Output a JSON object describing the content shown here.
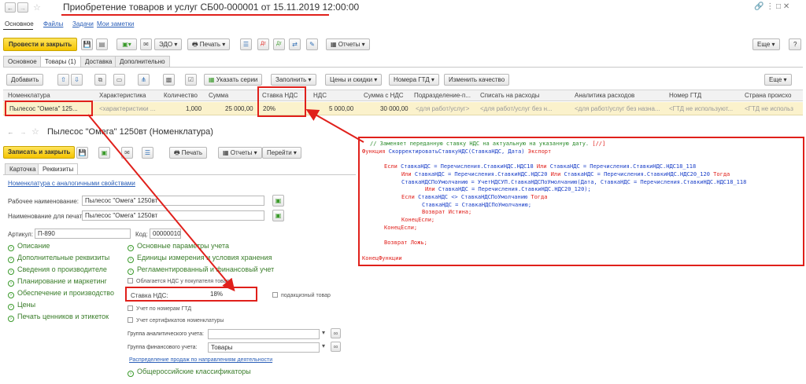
{
  "window": {
    "title": "Приобретение товаров и услуг СБ00-000001 от 15.11.2019 12:00:00"
  },
  "nav_tabs": [
    "Основное",
    "Файлы",
    "Задачи",
    "Мои заметки"
  ],
  "toolbar": {
    "post_close": "Провести и закрыть",
    "edo": "ЭДО",
    "print": "Печать",
    "reports": "Отчеты",
    "more": "Еще",
    "help": "?"
  },
  "doc_tabs": [
    "Основное",
    "Товары (1)",
    "Доставка",
    "Дополнительно"
  ],
  "goods_toolbar": {
    "add": "Добавить",
    "specify_series": "Указать серии",
    "fill": "Заполнить",
    "prices": "Цены и скидки",
    "gtd_numbers": "Номера ГТД",
    "change_quality": "Изменить качество",
    "more": "Еще"
  },
  "table": {
    "headers": [
      "Номенклатура",
      "Характеристика",
      "Количество",
      "Сумма",
      "Ставка НДС",
      "НДС",
      "Сумма с НДС",
      "Подразделение-п...",
      "Списать на расходы",
      "Аналитика расходов",
      "Номер ГТД",
      "Страна происхо"
    ],
    "row": [
      "Пылесос \"Омега\" 125...",
      "<характеристики ...",
      "1,000",
      "25 000,00",
      "20%",
      "5 000,00",
      "30 000,00",
      "<для работ/услуг>",
      "<для работ/услуг без н...",
      "<для работ/услуг без назна...",
      "<ГТД не используют...",
      "<ГТД не использ"
    ]
  },
  "item": {
    "title": "Пылесос \"Омега\" 1250вт (Номенклатура)",
    "save_close": "Записать и закрыть",
    "print": "Печать",
    "reports": "Отчеты",
    "goto": "Перейти",
    "tabs": [
      "Карточка",
      "Реквизиты"
    ],
    "analog_link": "Номенклатура с аналогичными свойствами",
    "work_name_label": "Рабочее наименование:",
    "work_name_value": "Пылесос \"Омега\" 1250вт",
    "print_name_label": "Наименование для печати:",
    "print_name_value": "Пылесос \"Омега\" 1250вт",
    "article_label": "Артикул:",
    "article_value": "П-890",
    "code_label": "Код:",
    "code_value": "000000104",
    "left_groups": [
      "Описание",
      "Дополнительные реквизиты",
      "Сведения о производителе",
      "Планирование и маркетинг",
      "Обеспечение и производство",
      "Цены",
      "Печать ценников и этикеток"
    ],
    "right_groups": [
      "Основные параметры учета",
      "Единицы измерения и условия хранения",
      "Регламентированный и финансовый учет"
    ],
    "vat_buyer": "Облагается НДС у покупателя товара",
    "vat_rate_label": "Ставка НДС:",
    "vat_rate_value": "18%",
    "excise": "подакцизный товар",
    "gtd_check": "Учет по номерам ГТД",
    "cert_check": "Учет сертификатов номенклатуры",
    "analytic_group_label": "Группа аналитического учета:",
    "analytic_group_value": "",
    "fin_group_label": "Группа финансового учета:",
    "fin_group_value": "Товары",
    "sales_link": "Распределение продаж по направлениям деятельности",
    "classifiers": "Общероссийские классификаторы"
  },
  "code": {
    "lines": [
      {
        "parts": [
          [
            "cm",
            "// Заменяет переданную ставку НДС на актуальную на указанную дату. "
          ],
          [
            "kw",
            "[//]"
          ]
        ]
      },
      {
        "parts": [
          [
            "kw",
            "Функция "
          ],
          [
            "tx",
            "СкорректироватьСтавкуНДС(СтавкаНДС, Дата) "
          ],
          [
            "kw",
            "Экспорт"
          ]
        ]
      },
      {
        "parts": []
      },
      {
        "parts": [
          [
            "kw",
            "Если "
          ],
          [
            "tx",
            "СтавкаНДС = Перечисления.СтавкиНДС.НДС18 "
          ],
          [
            "kw",
            "Или "
          ],
          [
            "tx",
            "СтавкаНДС = Перечисления.СтавкиНДС.НДС18_118"
          ]
        ]
      },
      {
        "parts": [
          [
            "kw",
            "Или "
          ],
          [
            "tx",
            "СтавкаНДС = Перечисления.СтавкиНДС.НДС20 "
          ],
          [
            "kw",
            "Или "
          ],
          [
            "tx",
            "СтавкаНДС = Перечисления.СтавкиНДС.НДС20_120 "
          ],
          [
            "kw",
            "Тогда"
          ]
        ]
      },
      {
        "parts": [
          [
            "tx",
            "СтавкаНДСПоУмолчанию = УчетНДСУП.СтавкаНДСПоУмолчанию(Дата, СтавкаНДС = Перечисления.СтавкиНДС.НДС18_118"
          ]
        ]
      },
      {
        "parts": [
          [
            "kw",
            "Или "
          ],
          [
            "tx",
            "СтавкаНДС = Перечисления.СтавкиНДС.НДС20_120);"
          ]
        ]
      },
      {
        "parts": [
          [
            "kw",
            "Если "
          ],
          [
            "tx",
            "СтавкаНДС <> СтавкаНДСПоУмолчанию "
          ],
          [
            "kw",
            "Тогда"
          ]
        ]
      },
      {
        "parts": [
          [
            "tx",
            "СтавкаНДС = СтавкаНДСПоУмолчанию;"
          ]
        ]
      },
      {
        "parts": [
          [
            "kw",
            "Возврат Истина;"
          ]
        ]
      },
      {
        "parts": [
          [
            "kw",
            "КонецЕсли;"
          ]
        ]
      },
      {
        "parts": [
          [
            "kw",
            "КонецЕсли;"
          ]
        ]
      },
      {
        "parts": []
      },
      {
        "parts": [
          [
            "kw",
            "Возврат Ложь;"
          ]
        ]
      },
      {
        "parts": []
      },
      {
        "parts": [
          [
            "kw",
            "КонецФункции"
          ]
        ]
      }
    ]
  },
  "colors": {
    "accent_red": "#e0201b",
    "primary_yellow": "#f5c400",
    "group_green": "#3a7d2a"
  }
}
